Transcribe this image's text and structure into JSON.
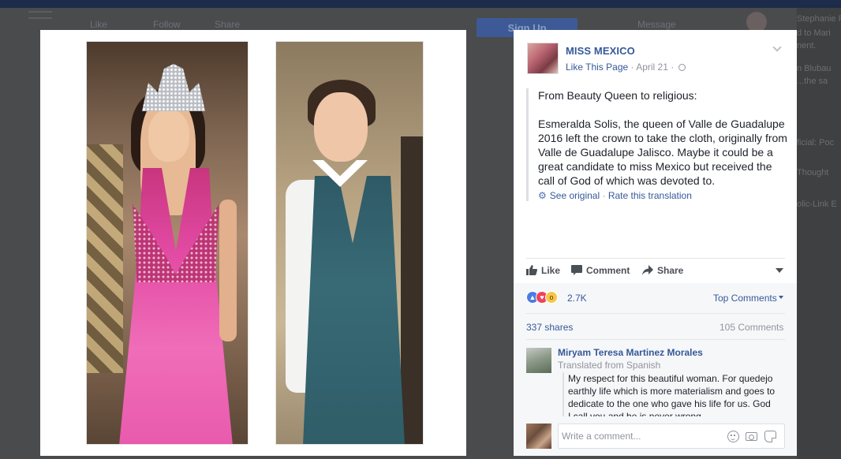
{
  "background": {
    "nav": [
      "Like",
      "Follow",
      "Share"
    ],
    "signup": "Sign Up",
    "message": "Message",
    "right_items": [
      "Stephanie Faz",
      "d to Mari",
      "nent.",
      "n Blubau",
      "...the sa",
      "ficial: Poc",
      "Thought",
      "olic-Link E"
    ]
  },
  "post": {
    "page_name": "MISS MEXICO",
    "like_page": "Like This Page",
    "date": "April 21",
    "paragraphs": [
      "From Beauty Queen to religious:",
      "Esmeralda Solis, the queen of Valle de Guadalupe 2016 left the crown to take the cloth, originally from Valle de Guadalupe Jalisco. Maybe it could be a great candidate to miss Mexico but received the call of God of which was devoted to."
    ],
    "see_original": "See original",
    "rate_translation": "Rate this translation"
  },
  "actions": {
    "like": "Like",
    "comment": "Comment",
    "share": "Share"
  },
  "stats": {
    "reaction_count": "2.7K",
    "top_comments": "Top Comments",
    "shares": "337 shares",
    "comments": "105 Comments"
  },
  "comment": {
    "author": "Miryam Teresa Martinez Morales",
    "translated": "Translated from Spanish",
    "text": "My respect for this beautiful woman. For quedejo earthly life which is more materialism and goes to dedicate to the one who gave his life for us. God I call you and he is never wrong."
  },
  "composer": {
    "placeholder": "Write a comment..."
  },
  "colors": {
    "link": "#365899",
    "meta": "#90949c",
    "like_reaction": "#4d7cdf",
    "love_reaction": "#f0425a",
    "wow_reaction": "#f7c64a"
  }
}
